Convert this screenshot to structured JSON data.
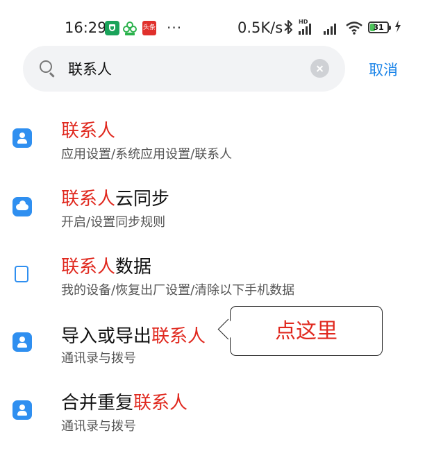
{
  "status_bar": {
    "time": "16:29",
    "news_badge": "头条",
    "more": "···",
    "net_speed": "0.5K/s",
    "hd": "HD",
    "battery_level": "31",
    "battery_fraction": 0.31,
    "icons": [
      "shield-icon",
      "clover-icon",
      "news-icon",
      "bluetooth-icon",
      "signal-icon",
      "wifi-icon",
      "battery-icon",
      "charging-icon"
    ]
  },
  "search": {
    "query": "联系人",
    "cancel_label": "取消"
  },
  "results": [
    {
      "title_pre": "",
      "title_hl": "联系人",
      "title_post": "",
      "subtitle": "应用设置/系统应用设置/联系人",
      "icon": "contacts-icon"
    },
    {
      "title_pre": "",
      "title_hl": "联系人",
      "title_post": "云同步",
      "subtitle": "开启/设置同步规则",
      "icon": "cloud-icon"
    },
    {
      "title_pre": "",
      "title_hl": "联系人",
      "title_post": "数据",
      "subtitle": "我的设备/恢复出厂设置/清除以下手机数据",
      "icon": "tablet-icon"
    },
    {
      "title_pre": "导入或导出",
      "title_hl": "联系人",
      "title_post": "",
      "subtitle": "通讯录与拨号",
      "icon": "contacts-icon"
    },
    {
      "title_pre": "合并重复",
      "title_hl": "联系人",
      "title_post": "",
      "subtitle": "通讯录与拨号",
      "icon": "contacts-icon"
    }
  ],
  "callout": {
    "text": "点这里"
  },
  "colors": {
    "accent": "#1b84e8",
    "highlight": "#e0281e",
    "icon_blue": "#2f8ff0"
  }
}
